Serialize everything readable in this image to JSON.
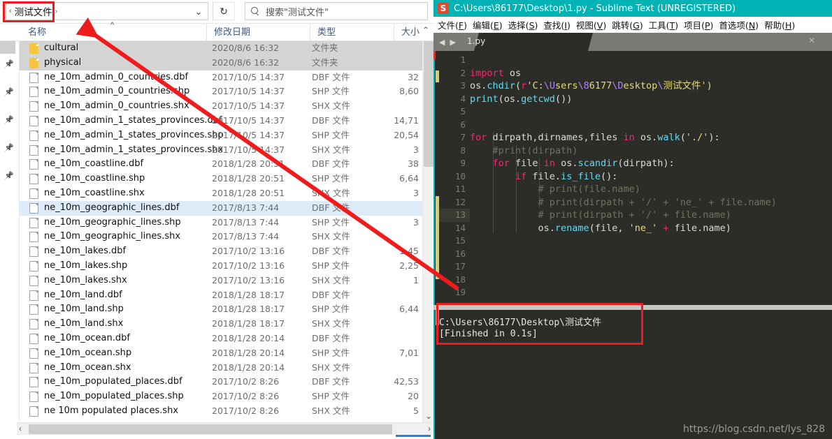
{
  "explorer": {
    "address": {
      "crumb": "测试文件",
      "separator": "›",
      "back_glyph": "‹",
      "caret": "⌄"
    },
    "refresh_label": "↻",
    "search": {
      "placeholder": "搜索\"测试文件\""
    },
    "columns": {
      "name": "名称",
      "date": "修改日期",
      "type": "类型",
      "size": "大小",
      "sort_indicator": "^"
    },
    "rows": [
      {
        "icon": "folder-icon",
        "name": "cultural",
        "date": "2020/8/6 16:32",
        "type": "文件夹",
        "size": "",
        "state": "selected-grey"
      },
      {
        "icon": "folder-icon",
        "name": "physical",
        "date": "2020/8/6 16:32",
        "type": "文件夹",
        "size": "",
        "state": "selected-grey"
      },
      {
        "icon": "file-icon",
        "name": "ne_10m_admin_0_countries.dbf",
        "date": "2017/10/5 14:37",
        "type": "DBF 文件",
        "size": "32",
        "state": "normal"
      },
      {
        "icon": "file-icon",
        "name": "ne_10m_admin_0_countries.shp",
        "date": "2017/10/5 14:37",
        "type": "SHP 文件",
        "size": "8,60",
        "state": "normal"
      },
      {
        "icon": "file-icon",
        "name": "ne_10m_admin_0_countries.shx",
        "date": "2017/10/5 14:37",
        "type": "SHX 文件",
        "size": "",
        "state": "normal"
      },
      {
        "icon": "file-icon",
        "name": "ne_10m_admin_1_states_provinces.dbf",
        "date": "2017/10/5 14:37",
        "type": "DBF 文件",
        "size": "14,71",
        "state": "normal"
      },
      {
        "icon": "file-icon",
        "name": "ne_10m_admin_1_states_provinces.shp",
        "date": "2017/10/5 14:37",
        "type": "SHP 文件",
        "size": "20,54",
        "state": "normal"
      },
      {
        "icon": "file-icon",
        "name": "ne_10m_admin_1_states_provinces.shx",
        "date": "2017/10/5 14:37",
        "type": "SHX 文件",
        "size": "3",
        "state": "normal"
      },
      {
        "icon": "file-icon",
        "name": "ne_10m_coastline.dbf",
        "date": "2018/1/28 20:51",
        "type": "DBF 文件",
        "size": "38",
        "state": "normal"
      },
      {
        "icon": "file-icon",
        "name": "ne_10m_coastline.shp",
        "date": "2018/1/28 20:51",
        "type": "SHP 文件",
        "size": "6,64",
        "state": "normal"
      },
      {
        "icon": "file-icon",
        "name": "ne_10m_coastline.shx",
        "date": "2018/1/28 20:51",
        "type": "SHX 文件",
        "size": "3",
        "state": "normal"
      },
      {
        "icon": "file-icon",
        "name": "ne_10m_geographic_lines.dbf",
        "date": "2017/8/13 7:44",
        "type": "DBF 文件",
        "size": "",
        "state": "selected-blue"
      },
      {
        "icon": "file-icon",
        "name": "ne_10m_geographic_lines.shp",
        "date": "2017/8/13 7:44",
        "type": "SHP 文件",
        "size": "3",
        "state": "normal"
      },
      {
        "icon": "file-icon",
        "name": "ne_10m_geographic_lines.shx",
        "date": "2017/8/13 7:44",
        "type": "SHX 文件",
        "size": "",
        "state": "normal"
      },
      {
        "icon": "file-icon",
        "name": "ne_10m_lakes.dbf",
        "date": "2017/10/2 13:16",
        "type": "DBF 文件",
        "size": "1,45",
        "state": "normal"
      },
      {
        "icon": "file-icon",
        "name": "ne_10m_lakes.shp",
        "date": "2017/10/2 13:16",
        "type": "SHP 文件",
        "size": "2,25",
        "state": "normal"
      },
      {
        "icon": "file-icon",
        "name": "ne_10m_lakes.shx",
        "date": "2017/10/2 13:16",
        "type": "SHX 文件",
        "size": "1",
        "state": "normal"
      },
      {
        "icon": "file-icon",
        "name": "ne_10m_land.dbf",
        "date": "2018/1/28 18:17",
        "type": "DBF 文件",
        "size": "",
        "state": "normal"
      },
      {
        "icon": "file-icon",
        "name": "ne_10m_land.shp",
        "date": "2018/1/28 18:17",
        "type": "SHP 文件",
        "size": "6,44",
        "state": "normal"
      },
      {
        "icon": "file-icon",
        "name": "ne_10m_land.shx",
        "date": "2018/1/28 18:17",
        "type": "SHX 文件",
        "size": "",
        "state": "normal"
      },
      {
        "icon": "file-icon",
        "name": "ne_10m_ocean.dbf",
        "date": "2018/1/28 20:14",
        "type": "DBF 文件",
        "size": "",
        "state": "normal"
      },
      {
        "icon": "file-icon",
        "name": "ne_10m_ocean.shp",
        "date": "2018/1/28 20:14",
        "type": "SHP 文件",
        "size": "7,01",
        "state": "normal"
      },
      {
        "icon": "file-icon",
        "name": "ne_10m_ocean.shx",
        "date": "2018/1/28 20:14",
        "type": "SHX 文件",
        "size": "",
        "state": "normal"
      },
      {
        "icon": "file-icon",
        "name": "ne_10m_populated_places.dbf",
        "date": "2017/10/2 8:26",
        "type": "DBF 文件",
        "size": "42,53",
        "state": "normal"
      },
      {
        "icon": "file-icon",
        "name": "ne_10m_populated_places.shp",
        "date": "2017/10/2 8:26",
        "type": "SHP 文件",
        "size": "20",
        "state": "normal"
      },
      {
        "icon": "file-icon",
        "name": "ne 10m populated places.shx",
        "date": "2017/10/2 8:26",
        "type": "SHX 文件",
        "size": "5",
        "state": "normal"
      }
    ],
    "scrollbar": {
      "up_glyph": "⌃",
      "down_glyph": "⌄",
      "left_glyph": "‹",
      "right_glyph": "›"
    },
    "nav_pins": [
      "pin-icon",
      "pin-icon",
      "pin-icon",
      "pin-icon",
      "pin-icon"
    ]
  },
  "sublime": {
    "title": "C:\\Users\\86177\\Desktop\\1.py - Sublime Text (UNREGISTERED)",
    "logo_letter": "S",
    "menu": [
      {
        "label": "文件",
        "accel": "F"
      },
      {
        "label": "编辑",
        "accel": "E"
      },
      {
        "label": "选择",
        "accel": "S"
      },
      {
        "label": "查找",
        "accel": "I"
      },
      {
        "label": "视图",
        "accel": "V"
      },
      {
        "label": "跳转",
        "accel": "G"
      },
      {
        "label": "工具",
        "accel": "T"
      },
      {
        "label": "项目",
        "accel": "P"
      },
      {
        "label": "首选项",
        "accel": "N"
      },
      {
        "label": "帮助",
        "accel": "H"
      }
    ],
    "tab": {
      "label": "1.py",
      "close_glyph": "✕"
    },
    "nav_arrows": "◀ ▶",
    "line_numbers": [
      1,
      2,
      3,
      4,
      5,
      6,
      7,
      8,
      9,
      10,
      11,
      12,
      13,
      14,
      15,
      16,
      17,
      18,
      19
    ],
    "active_line": 13,
    "code_lines": [
      {
        "n": 1,
        "tokens": []
      },
      {
        "n": 2,
        "tokens": [
          {
            "t": "import",
            "c": "k-kw"
          },
          {
            "t": " os",
            "c": ""
          }
        ]
      },
      {
        "n": 3,
        "tokens": [
          {
            "t": "os.",
            "c": ""
          },
          {
            "t": "chdir",
            "c": "k-fn"
          },
          {
            "t": "(",
            "c": ""
          },
          {
            "t": "r",
            "c": "k-kw"
          },
          {
            "t": "'C:",
            "c": "k-str"
          },
          {
            "t": "\\U",
            "c": "k-esc"
          },
          {
            "t": "sers",
            "c": "k-str"
          },
          {
            "t": "\\8",
            "c": "k-esc"
          },
          {
            "t": "6177",
            "c": "k-str"
          },
          {
            "t": "\\D",
            "c": "k-esc"
          },
          {
            "t": "esktop",
            "c": "k-str"
          },
          {
            "t": "\\",
            "c": "k-esc"
          },
          {
            "t": "测试文件')",
            "c": "k-str"
          }
        ]
      },
      {
        "n": 4,
        "tokens": [
          {
            "t": "print",
            "c": "k-fn"
          },
          {
            "t": "(os.",
            "c": ""
          },
          {
            "t": "getcwd",
            "c": "k-fn"
          },
          {
            "t": "())",
            "c": ""
          }
        ]
      },
      {
        "n": 5,
        "tokens": []
      },
      {
        "n": 6,
        "tokens": []
      },
      {
        "n": 7,
        "tokens": [
          {
            "t": "for",
            "c": "k-kw"
          },
          {
            "t": " dirpath,dirnames,files ",
            "c": ""
          },
          {
            "t": "in",
            "c": "k-kw"
          },
          {
            "t": " os.",
            "c": ""
          },
          {
            "t": "walk",
            "c": "k-fn"
          },
          {
            "t": "(",
            "c": ""
          },
          {
            "t": "'./'",
            "c": "k-str"
          },
          {
            "t": "):",
            "c": ""
          }
        ]
      },
      {
        "n": 8,
        "tokens": [
          {
            "t": "    #print(dirpath)",
            "c": "k-cm"
          }
        ]
      },
      {
        "n": 9,
        "tokens": [
          {
            "t": "    ",
            "c": ""
          },
          {
            "t": "for",
            "c": "k-kw"
          },
          {
            "t": " file ",
            "c": ""
          },
          {
            "t": "in",
            "c": "k-kw"
          },
          {
            "t": " os.",
            "c": ""
          },
          {
            "t": "scandir",
            "c": "k-fn"
          },
          {
            "t": "(dirpath):",
            "c": ""
          }
        ]
      },
      {
        "n": 10,
        "tokens": [
          {
            "t": "        ",
            "c": ""
          },
          {
            "t": "if",
            "c": "k-kw"
          },
          {
            "t": " file.",
            "c": ""
          },
          {
            "t": "is_file",
            "c": "k-fn"
          },
          {
            "t": "():",
            "c": ""
          }
        ]
      },
      {
        "n": 11,
        "tokens": [
          {
            "t": "            # print(file.name)",
            "c": "k-cm"
          }
        ]
      },
      {
        "n": 12,
        "tokens": [
          {
            "t": "            # print(dirpath + '/' + 'ne_' + file.name)",
            "c": "k-cm"
          }
        ]
      },
      {
        "n": 13,
        "tokens": [
          {
            "t": "            # print(dirpath + '/' + file.name)",
            "c": "k-cm"
          }
        ]
      },
      {
        "n": 14,
        "tokens": [
          {
            "t": "            os.",
            "c": ""
          },
          {
            "t": "rename",
            "c": "k-fn"
          },
          {
            "t": "(file, ",
            "c": ""
          },
          {
            "t": "'ne_'",
            "c": "k-str"
          },
          {
            "t": " ",
            "c": ""
          },
          {
            "t": "+",
            "c": "k-pl"
          },
          {
            "t": " file.name)",
            "c": ""
          }
        ]
      },
      {
        "n": 15,
        "tokens": []
      },
      {
        "n": 16,
        "tokens": []
      },
      {
        "n": 17,
        "tokens": []
      },
      {
        "n": 18,
        "tokens": []
      },
      {
        "n": 19,
        "tokens": []
      }
    ],
    "console": {
      "line1": "C:\\Users\\86177\\Desktop\\测试文件",
      "line2": "[Finished in 0.1s]"
    },
    "watermark": "https://blog.csdn.net/lys_828"
  },
  "annotations": {
    "highlight_color": "#ef1c1c",
    "arrow_color": "#ef1c1c"
  }
}
